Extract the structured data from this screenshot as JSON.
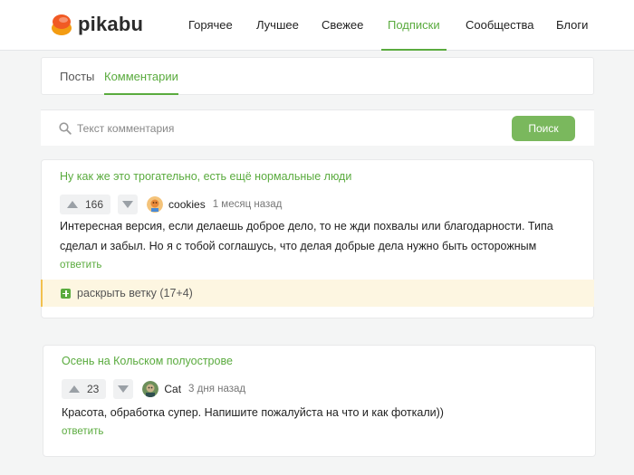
{
  "header": {
    "brand": "pikabu",
    "nav": [
      {
        "label": "Горячее"
      },
      {
        "label": "Лучшее"
      },
      {
        "label": "Свежее"
      },
      {
        "label": "Подписки"
      },
      {
        "label": "Сообщества"
      },
      {
        "label": "Блоги"
      }
    ],
    "active_nav": "Подписки"
  },
  "tabs": [
    {
      "label": "Посты"
    },
    {
      "label": "Комментарии"
    }
  ],
  "active_tab": "Комментарии",
  "search": {
    "placeholder": "Текст комментария",
    "button_label": "Поиск"
  },
  "comments": [
    {
      "story_title": "Ну как же это трогательно, есть ещё нормальные люди",
      "rating": "166",
      "username": "cookies",
      "time": "1 месяц назад",
      "text_lines": [
        "Интересная версия, если делаешь доброе дело, то не жди похвалы или благодарности. Типа",
        "сделал и забыл. Но я с тобой соглашусь, что делая добрые дела нужно быть осторожным"
      ],
      "reply_label": "ответить",
      "expand_label": "раскрыть ветку (17+4)"
    },
    {
      "story_title": "Осень на Кольском полуострове",
      "rating": "23",
      "username": "Cat",
      "time": "3 дня назад",
      "text_lines": [
        "Красота, обработка супер. Напишите пожалуйста на что и как фоткали))"
      ],
      "reply_label": "ответить"
    }
  ],
  "colors": {
    "accent": "#5aab3e",
    "search_button": "#7ab85d",
    "expand_bg": "#fdf6e1",
    "expand_border": "#f2c14e"
  }
}
